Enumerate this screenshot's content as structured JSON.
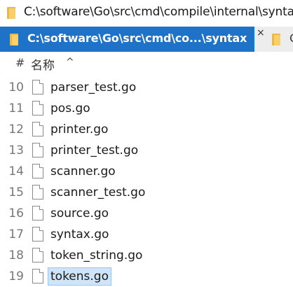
{
  "path_bar": {
    "path": "C:\\software\\Go\\src\\cmd\\compile\\internal\\syntax",
    "icon": "folder-icon"
  },
  "tabs": [
    {
      "label": "C:\\software\\Go\\src\\cmd\\co...\\syntax",
      "active": true,
      "close": "×"
    },
    {
      "label": "G",
      "active": false
    }
  ],
  "columns": {
    "index": "#",
    "name": "名称",
    "sort": "^"
  },
  "files": [
    {
      "num": "10",
      "name": "parser_test.go"
    },
    {
      "num": "11",
      "name": "pos.go"
    },
    {
      "num": "12",
      "name": "printer.go"
    },
    {
      "num": "13",
      "name": "printer_test.go"
    },
    {
      "num": "14",
      "name": "scanner.go"
    },
    {
      "num": "15",
      "name": "scanner_test.go"
    },
    {
      "num": "16",
      "name": "source.go"
    },
    {
      "num": "17",
      "name": "syntax.go"
    },
    {
      "num": "18",
      "name": "token_string.go"
    },
    {
      "num": "19",
      "name": "tokens.go",
      "selected": true
    }
  ],
  "colors": {
    "active_tab": "#1e72c8",
    "selection": "#cfe4f7",
    "folder": "#f7d06b"
  }
}
